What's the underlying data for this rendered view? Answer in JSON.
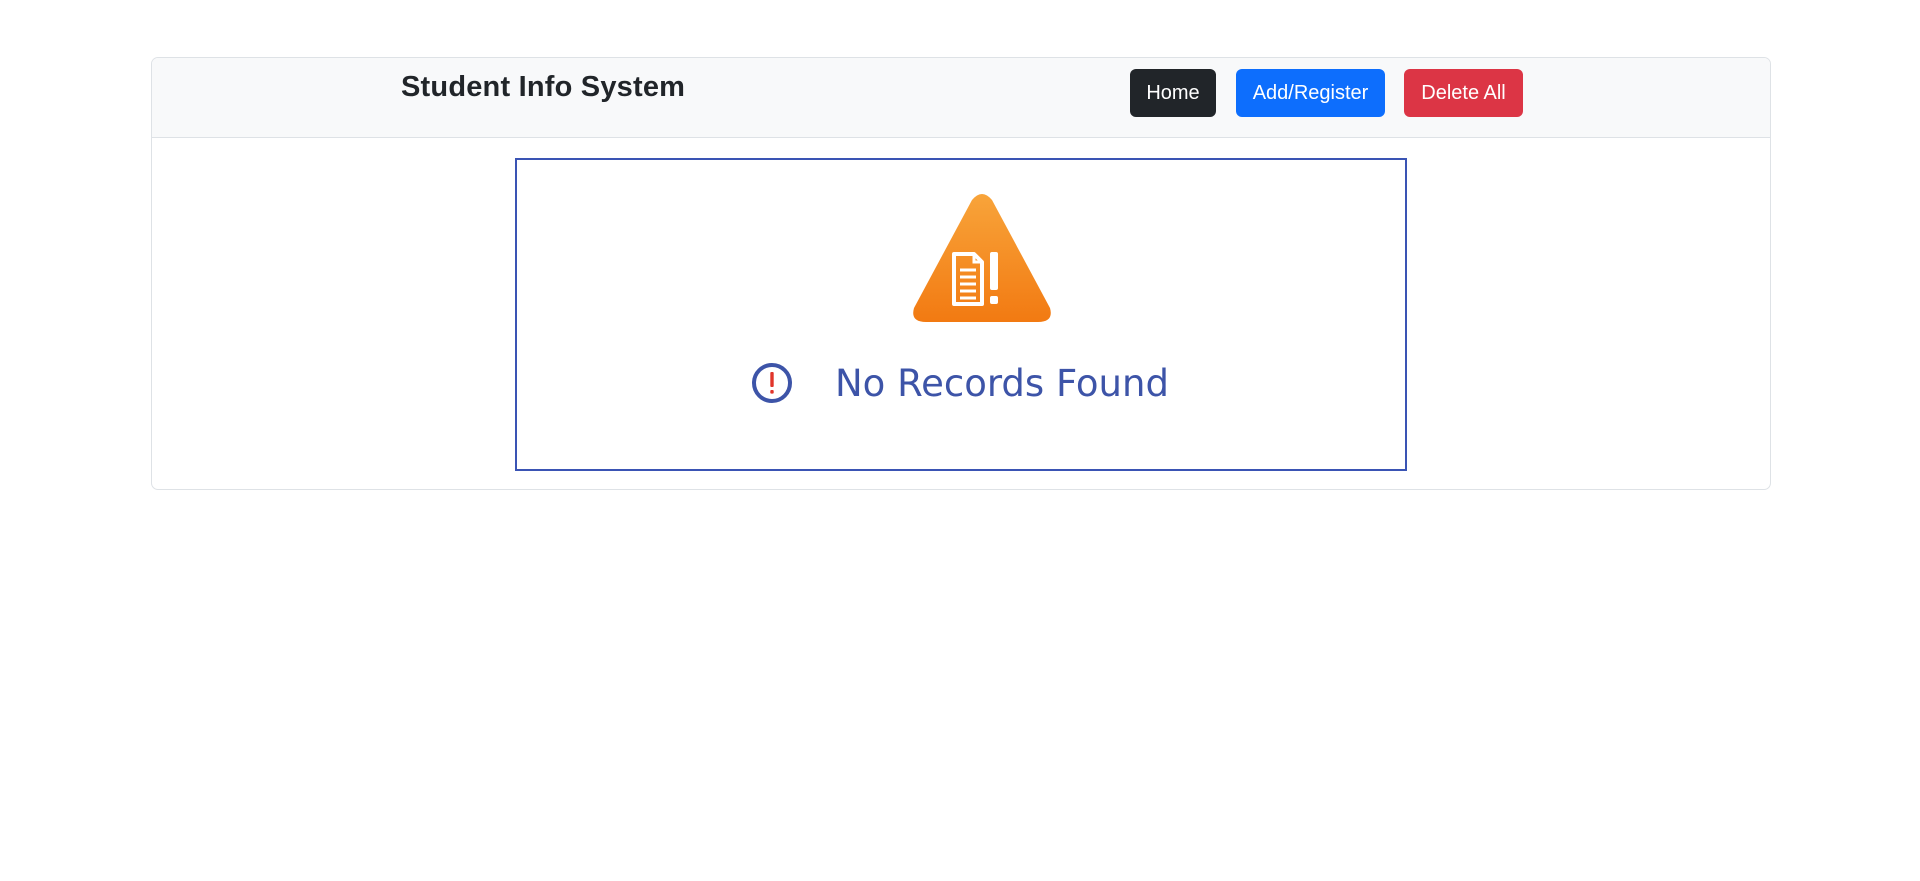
{
  "header": {
    "title": "Student Info System",
    "buttons": {
      "home_label": "Home",
      "add_label": "Add/Register",
      "delete_all_label": "Delete All"
    }
  },
  "empty_state": {
    "message": "No Records Found",
    "graphic_icon": "document-warning-triangle-icon",
    "message_icon": "info-circle-icon"
  },
  "colors": {
    "home_button": "#212529",
    "add_button": "#0d6efd",
    "delete_button": "#dc3545",
    "empty_border": "#3a54b4",
    "warning_orange": "#f7941d",
    "message_text": "#3d54a8"
  }
}
